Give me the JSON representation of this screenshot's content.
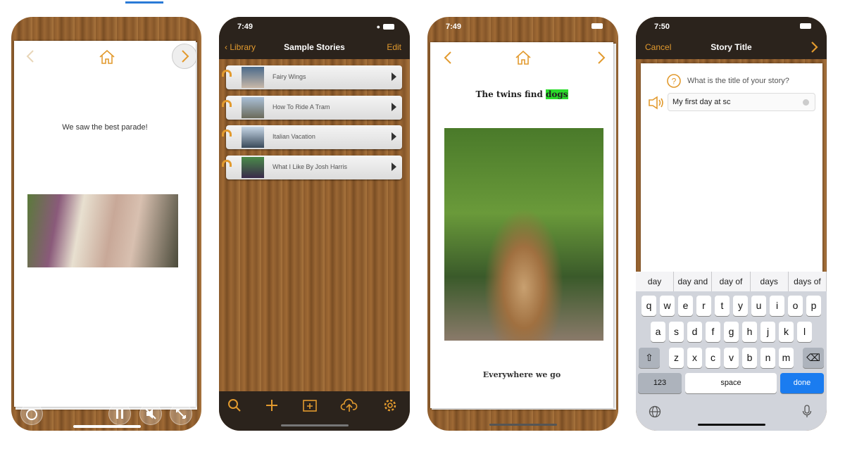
{
  "colors": {
    "accent": "#e29a2e",
    "highlight": "#2bdc2b",
    "dark_bar": "#2b231c",
    "done_blue": "#1a7cf0"
  },
  "screen1": {
    "caption": "We saw the best parade!",
    "icons": [
      "chevron-left-icon",
      "home-icon",
      "chevron-right-icon",
      "replay-icon",
      "pause-icon",
      "mute-icon",
      "fullscreen-icon"
    ]
  },
  "screen2": {
    "time": "7:49",
    "back": "Library",
    "title": "Sample Stories",
    "edit": "Edit",
    "stories": [
      {
        "label": "Fairy Wings"
      },
      {
        "label": "How To Ride A Tram"
      },
      {
        "label": "Italian Vacation"
      },
      {
        "label": "What I Like By Josh Harris"
      }
    ],
    "toolbar": [
      "search-icon",
      "plus-icon",
      "add-folder-icon",
      "cloud-upload-icon",
      "gear-icon"
    ]
  },
  "screen3": {
    "time": "7:49",
    "heading_prefix": "The twins find ",
    "heading_highlight": "dogs",
    "caption": "Everywhere we go"
  },
  "screen4": {
    "time": "7:50",
    "cancel": "Cancel",
    "title": "Story Title",
    "prompt": "What is the title of your story?",
    "input_value": "My first day at sc",
    "suggestions": [
      "day",
      "day and",
      "day of",
      "days",
      "days of"
    ],
    "rows": [
      [
        "q",
        "w",
        "e",
        "r",
        "t",
        "y",
        "u",
        "i",
        "o",
        "p"
      ],
      [
        "a",
        "s",
        "d",
        "f",
        "g",
        "h",
        "j",
        "k",
        "l"
      ],
      [
        "z",
        "x",
        "c",
        "v",
        "b",
        "n",
        "m"
      ]
    ],
    "numbers_key": "123",
    "space_key": "space",
    "done_key": "done"
  }
}
